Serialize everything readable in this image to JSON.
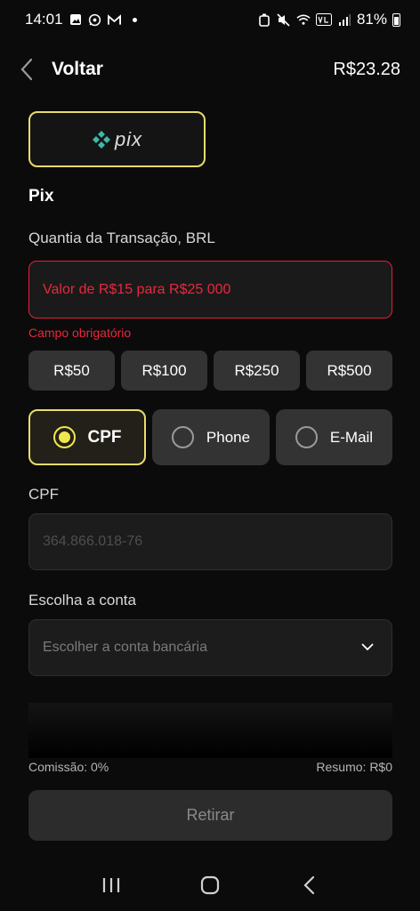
{
  "status_bar": {
    "time": "14:01",
    "battery": "81%",
    "left_icons": [
      "gallery-icon",
      "whatsapp-icon",
      "gmail-icon"
    ],
    "right_icons": [
      "alarm-icon",
      "mute-icon",
      "wifi-icon",
      "volte-icon",
      "signal-icon",
      "battery-icon"
    ]
  },
  "header": {
    "back_label": "Voltar",
    "balance": "R$23.28"
  },
  "method": {
    "logo_text": "pix",
    "title": "Pix"
  },
  "amount": {
    "label": "Quantia da Transação, BRL",
    "placeholder": "Valor de R$15 para R$25 000",
    "error": "Campo obrigatório",
    "quick_amounts": [
      "R$50",
      "R$100",
      "R$250",
      "R$500"
    ]
  },
  "key_type": {
    "options": [
      {
        "label": "CPF",
        "selected": true
      },
      {
        "label": "Phone",
        "selected": false
      },
      {
        "label": "E-Mail",
        "selected": false
      }
    ]
  },
  "cpf": {
    "label": "CPF",
    "placeholder": "364.866.018-76"
  },
  "account": {
    "label": "Escolha a conta",
    "placeholder": "Escolher a conta bancária"
  },
  "summary": {
    "commission": "Comissão: 0%",
    "total": "Resumo: R$0"
  },
  "submit_label": "Retirar",
  "colors": {
    "accent": "#e9dc6b",
    "error": "#e8283e",
    "background": "#0b0b0b"
  }
}
